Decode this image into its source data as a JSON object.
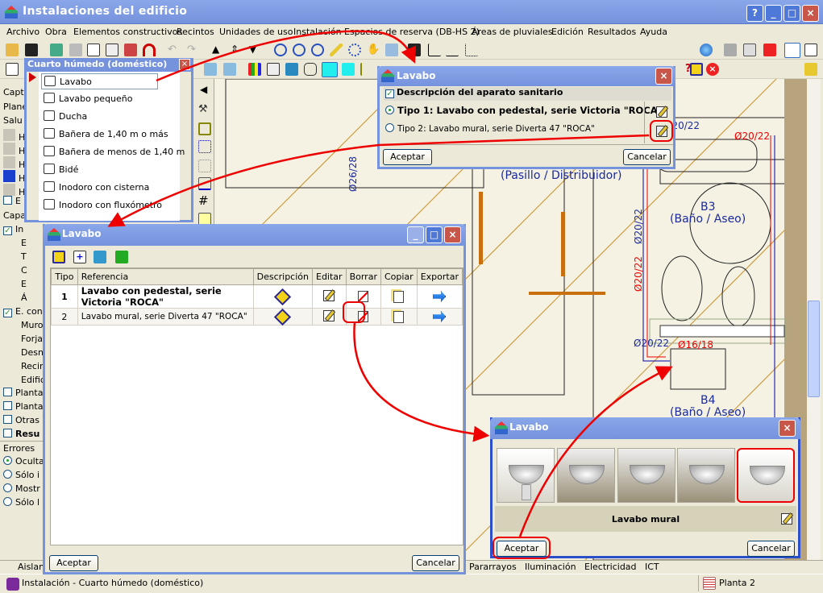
{
  "window": {
    "title": "Instalaciones del edificio",
    "controls": [
      "?",
      "_",
      "□",
      "×"
    ]
  },
  "menu": [
    "Archivo",
    "Obra",
    "Elementos constructivos",
    "Recintos",
    "Unidades de uso",
    "Instalación",
    "Espacios de reserva (DB-HS 2)",
    "Áreas de pluviales",
    "Edición",
    "Resultados",
    "Ayuda"
  ],
  "left_panel": {
    "rows": [
      "Capt",
      "Plane",
      "Salu",
      "H",
      "H",
      "H",
      "H",
      "H",
      "E",
      "Capa",
      "In",
      "E",
      "T",
      "C",
      "E",
      "Á",
      "E. con",
      "Muros",
      "Forjac",
      "Desni",
      "Recin",
      "Edifici",
      "Planta",
      "Planta",
      "Otras",
      "Resu"
    ],
    "errors_label": "Errores",
    "error_options": [
      "Oculta",
      "Sólo i",
      "Mostr",
      "Sólo l"
    ]
  },
  "fixture_popup": {
    "title": "Cuarto húmedo (doméstico)",
    "items": [
      "Lavabo",
      "Lavabo pequeño",
      "Ducha",
      "Bañera de 1,40 m o más",
      "Bañera de menos de 1,40 m",
      "Bidé",
      "Inodoro con cisterna",
      "Inodoro con fluxómetro"
    ]
  },
  "dialog_select": {
    "title": "Lavabo",
    "header": "Descripción del aparato sanitario",
    "options": [
      "Tipo 1: Lavabo con pedestal, serie Victoria \"ROCA\"",
      "Tipo 2: Lavabo mural, serie Diverta 47 \"ROCA\""
    ],
    "accept": "Aceptar",
    "cancel": "Cancelar"
  },
  "dialog_types": {
    "title": "Lavabo",
    "columns": [
      "Tipo",
      "Referencia",
      "Descripción",
      "Editar",
      "Borrar",
      "Copiar",
      "Exportar"
    ],
    "rows": [
      {
        "tipo": "1",
        "ref": "Lavabo con pedestal, serie Victoria \"ROCA\""
      },
      {
        "tipo": "2",
        "ref": "Lavabo mural, serie Diverta 47 \"ROCA\""
      }
    ],
    "accept": "Aceptar",
    "cancel": "Cancelar"
  },
  "dialog_model": {
    "title": "Lavabo",
    "selected_label": "Lavabo mural",
    "selected_index": 4,
    "thumb_count": 5,
    "accept": "Aceptar",
    "cancel": "Cancelar"
  },
  "drawing": {
    "labels": [
      "(Pasillo / Distribuidor)",
      "B3",
      "(Baño / Aseo)",
      "B4",
      "(Baño / Aseo)"
    ],
    "pipes": [
      "Ø20/22",
      "Ø20/22",
      "Ø20/22",
      "Ø20/22",
      "Ø26/28",
      "Ø20/22",
      "Ø16/18"
    ]
  },
  "bottom_tabs": [
    "Aislam",
    "Pararrayos",
    "Iluminación",
    "Electricidad",
    "ICT"
  ],
  "status": {
    "text": "Instalación - Cuarto húmedo (doméstico)",
    "floor": "Planta 2"
  },
  "colors": {
    "title_bar": "#7592dd",
    "annotation": "#e00000",
    "canvas": "#f5f2e3"
  }
}
